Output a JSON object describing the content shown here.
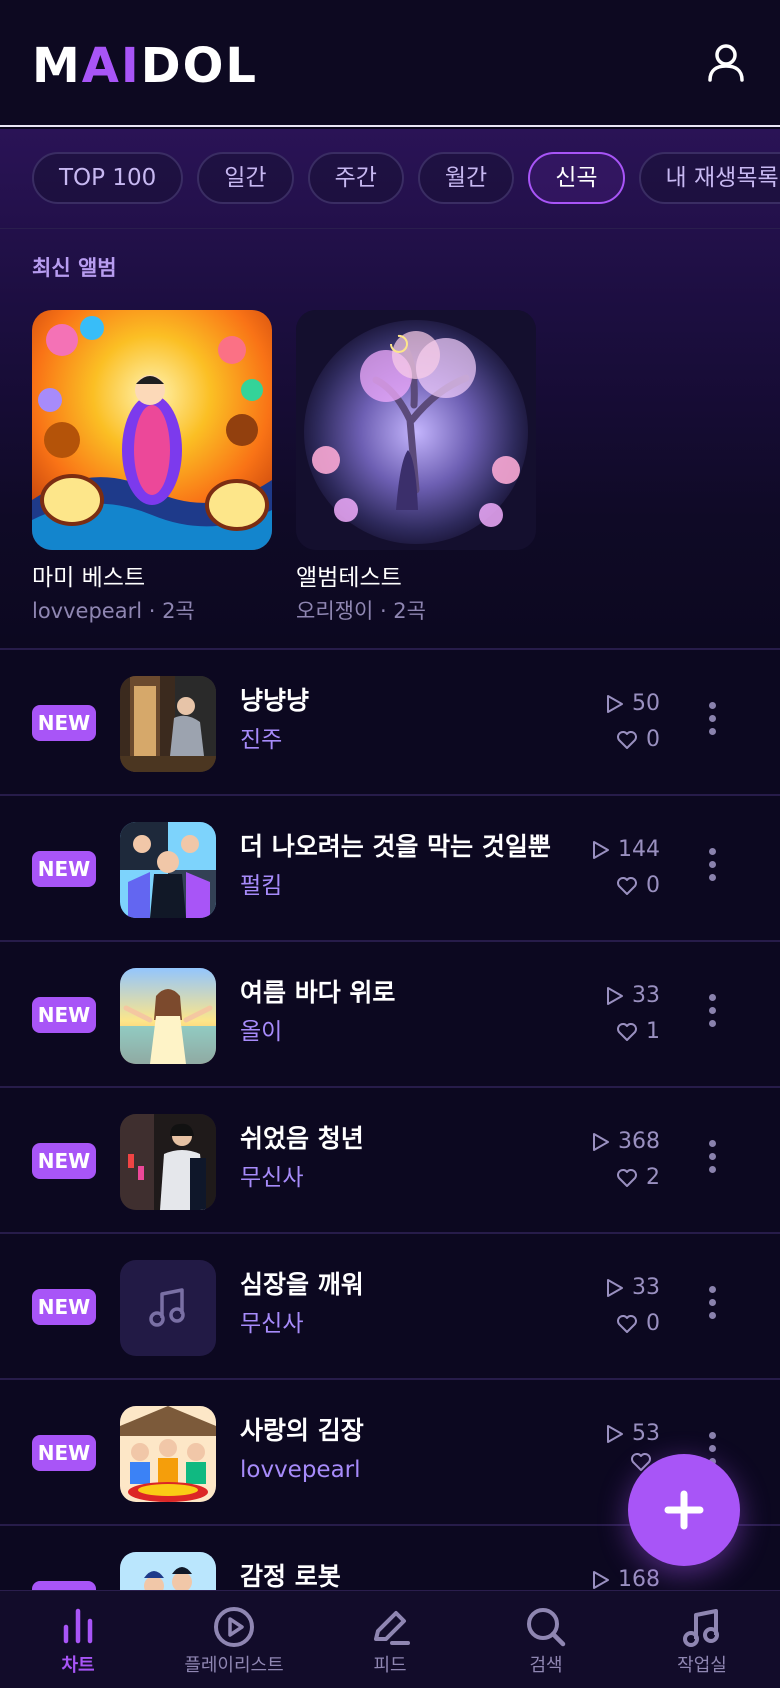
{
  "header": {
    "logo_part1": "M",
    "logo_part2": "AI",
    "logo_part3": "DOL",
    "profile_icon": "user-icon"
  },
  "tabs": [
    {
      "label": "TOP 100",
      "active": false
    },
    {
      "label": "일간",
      "active": false
    },
    {
      "label": "주간",
      "active": false
    },
    {
      "label": "월간",
      "active": false
    },
    {
      "label": "신곡",
      "active": true
    },
    {
      "label": "내 재생목록",
      "active": false
    }
  ],
  "latest_albums": {
    "title": "최신 앨범",
    "items": [
      {
        "title": "마미 베스트",
        "meta": "lovvepearl · 2곡"
      },
      {
        "title": "앨범테스트",
        "meta": "오리쟁이 · 2곡"
      }
    ]
  },
  "songs": [
    {
      "badge": "NEW",
      "title": "냥냥냥",
      "artist": "진주",
      "plays": "50",
      "likes": "0"
    },
    {
      "badge": "NEW",
      "title": "더 나오려는 것을 막는 것일뿐",
      "artist": "펄킴",
      "plays": "144",
      "likes": "0"
    },
    {
      "badge": "NEW",
      "title": "여름 바다 위로",
      "artist": "올이",
      "plays": "33",
      "likes": "1"
    },
    {
      "badge": "NEW",
      "title": "쉬었음 청년",
      "artist": "무신사",
      "plays": "368",
      "likes": "2"
    },
    {
      "badge": "NEW",
      "title": "심장을 깨워",
      "artist": "무신사",
      "plays": "33",
      "likes": "0"
    },
    {
      "badge": "NEW",
      "title": "사랑의 김장",
      "artist": "lovvepearl",
      "plays": "53",
      "likes": ""
    },
    {
      "badge": "NEW",
      "title": "감정 로봇",
      "artist": "",
      "plays": "168",
      "likes": ""
    }
  ],
  "bottom_nav": [
    {
      "label": "차트",
      "icon": "chart-bars-icon",
      "active": true
    },
    {
      "label": "플레이리스트",
      "icon": "play-circle-icon",
      "active": false
    },
    {
      "label": "피드",
      "icon": "pen-icon",
      "active": false
    },
    {
      "label": "검색",
      "icon": "search-icon",
      "active": false
    },
    {
      "label": "작업실",
      "icon": "music-note-icon",
      "active": false
    }
  ],
  "colors": {
    "accent": "#a855f7",
    "background": "#0c0820",
    "artist_text": "#a78bfa"
  }
}
